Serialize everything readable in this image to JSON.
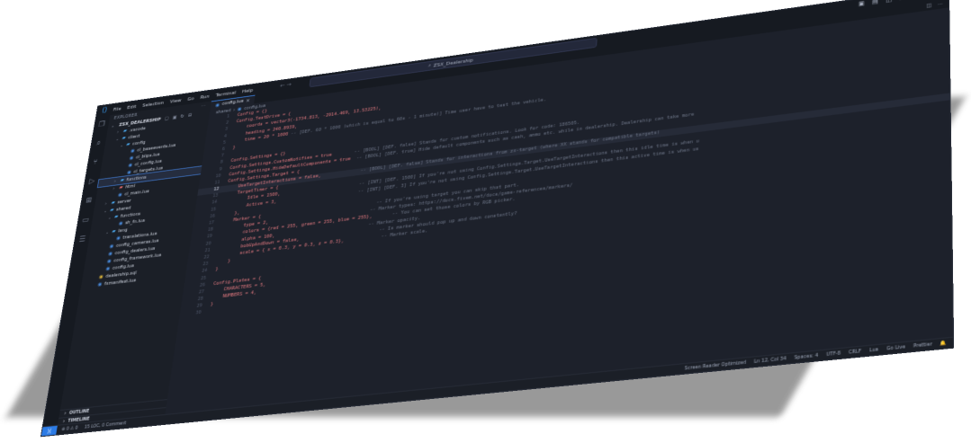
{
  "titlebar": {
    "menu": [
      "File",
      "Edit",
      "Selection",
      "View",
      "Go",
      "Run",
      "Terminal",
      "Help"
    ],
    "search": "ZSX_Dealership"
  },
  "sidebar": {
    "title": "EXPLORER",
    "project": "ZSX_DEALERSHIP",
    "tree": [
      {
        "label": ".vscode",
        "kind": "folder",
        "depth": 1,
        "open": false
      },
      {
        "label": "client",
        "kind": "folder",
        "depth": 1,
        "open": true
      },
      {
        "label": "config",
        "kind": "folder",
        "depth": 2,
        "open": true
      },
      {
        "label": "cl_baseevents.lua",
        "kind": "lua",
        "depth": 3
      },
      {
        "label": "cl_blips.lua",
        "kind": "lua",
        "depth": 3
      },
      {
        "label": "cl_config.lua",
        "kind": "lua",
        "depth": 3
      },
      {
        "label": "cl_targets.lua",
        "kind": "lua",
        "depth": 3
      },
      {
        "label": "functions",
        "kind": "folder",
        "depth": 2,
        "open": false,
        "selected": true
      },
      {
        "label": "html",
        "kind": "folder-red",
        "depth": 2,
        "open": false
      },
      {
        "label": "cl_main.lua",
        "kind": "lua",
        "depth": 2
      },
      {
        "label": "server",
        "kind": "folder",
        "depth": 1,
        "open": false
      },
      {
        "label": "shared",
        "kind": "folder",
        "depth": 1,
        "open": true
      },
      {
        "label": "functions",
        "kind": "folder",
        "depth": 2,
        "open": true
      },
      {
        "label": "sh_fn.lua",
        "kind": "lua",
        "depth": 3
      },
      {
        "label": "lang",
        "kind": "folder",
        "depth": 2,
        "open": true
      },
      {
        "label": "translations.lua",
        "kind": "lua",
        "depth": 3
      },
      {
        "label": "config_cameras.lua",
        "kind": "lua",
        "depth": 2
      },
      {
        "label": "config_dealers.lua",
        "kind": "lua",
        "depth": 2
      },
      {
        "label": "config_framework.lua",
        "kind": "lua",
        "depth": 2
      },
      {
        "label": "config.lua",
        "kind": "lua",
        "depth": 2
      },
      {
        "label": "dealership.sql",
        "kind": "sql",
        "depth": 1
      },
      {
        "label": "fxmanifest.lua",
        "kind": "lua",
        "depth": 1
      }
    ],
    "outline": "OUTLINE",
    "timeline": "TIMELINE"
  },
  "editor": {
    "tab": "config.lua",
    "breadcrumb": [
      "shared",
      "config.lua"
    ],
    "active_line": 12,
    "lines": [
      {
        "n": "1",
        "code": "Config = {}",
        "comment": ""
      },
      {
        "n": "2",
        "code": "Config.TestDrive = {",
        "comment": ""
      },
      {
        "n": "3",
        "code": "    coords = vector3(-1734.813, -2914.469, 13.53225),",
        "comment": ""
      },
      {
        "n": "4",
        "code": "    heading = 240.8939,",
        "comment": ""
      },
      {
        "n": "5",
        "code": "    time = 20 * 1000",
        "comment": " -- [DEF. 60 * 1000 (which is equal to 60s - 1 minute)] Time user have to test the vehicle."
      },
      {
        "n": "6",
        "code": "}",
        "comment": ""
      },
      {
        "n": "7",
        "code": "",
        "comment": ""
      },
      {
        "n": "8",
        "code": "Config.Settings = {}",
        "comment": ""
      },
      {
        "n": "9",
        "code": "Config.Settings.CustomNotifies = true",
        "comment": "        -- [BOOL] [DEF. false] Stands for custom notifications. Look for code: 186505."
      },
      {
        "n": "10",
        "code": "Config.Settings.HideDefaultComponents = true",
        "comment": "  -- [BOOL] [DEF. true] Hide default components such as cash, ammo etc. while in dealership. Dealership can take more"
      },
      {
        "n": "11",
        "code": "Config.Settings.Target = {",
        "comment": ""
      },
      {
        "n": "12",
        "code": "    UseTargetInteractions = false,",
        "comment": "              -- [BOOL] [DEF. false] Stands for interactions from zx-target (where XX stands for compatible targets)"
      },
      {
        "n": "13",
        "code": "    TargetTimer = {",
        "comment": ""
      },
      {
        "n": "14",
        "code": "        Idle = 1500,",
        "comment": "                            -- [INT] [DEF. 1500] If you're not using Config.Settings.Target.UseTargetInteractions then this idle time is when u"
      },
      {
        "n": "15",
        "code": "        Active = 3,",
        "comment": "                             -- [INT] [DEF. 3] If you're not using Config.Settings.Target.UseTargetInteractions then this active time is when us"
      },
      {
        "n": "16",
        "code": "    },",
        "comment": ""
      },
      {
        "n": "17",
        "code": "    Marker = {",
        "comment": "                                         -- If you're using target you can skip that part."
      },
      {
        "n": "18",
        "code": "        type = 2,",
        "comment": "                                    -- Marker types: https://docs.fivem.net/docs/game-references/markers/"
      },
      {
        "n": "19",
        "code": "        colors = {red = 255, green = 255, blue = 255},",
        "comment": "       -- You can set those colors by RGB picker."
      },
      {
        "n": "20",
        "code": "        alpha = 100,",
        "comment": "                                 -- Marker opacity."
      },
      {
        "n": "21",
        "code": "        bobUpAndDown = false,",
        "comment": "                            -- Is marker should pop up and down constantly?"
      },
      {
        "n": "22",
        "code": "        scale = { x = 0.3, y = 0.3, z = 0.3},",
        "comment": "             -- Marker scale."
      },
      {
        "n": "23",
        "code": "    }",
        "comment": ""
      },
      {
        "n": "24",
        "code": "}",
        "comment": ""
      },
      {
        "n": "25",
        "code": "",
        "comment": ""
      },
      {
        "n": "26",
        "code": "Config.Plates = {",
        "comment": ""
      },
      {
        "n": "27",
        "code": "    CHARACTERS = 5,",
        "comment": ""
      },
      {
        "n": "28",
        "code": "    NUMBERS = 4,",
        "comment": ""
      },
      {
        "n": "29",
        "code": "}",
        "comment": ""
      },
      {
        "n": "30",
        "code": "",
        "comment": ""
      }
    ]
  },
  "statusbar": {
    "left": [
      "⊗ 0  ⚠ 0",
      "15 LOC, 0 Comment"
    ],
    "right": [
      "Screen Reader Optimized",
      "Ln 12, Col 34",
      "Spaces: 4",
      "UTF-8",
      "CRLF",
      "Lua",
      "Go Live",
      "Prettier"
    ]
  },
  "colors": {
    "accent": "#2c7be5",
    "code_red": "#e0787f",
    "comment": "#6c7486"
  }
}
